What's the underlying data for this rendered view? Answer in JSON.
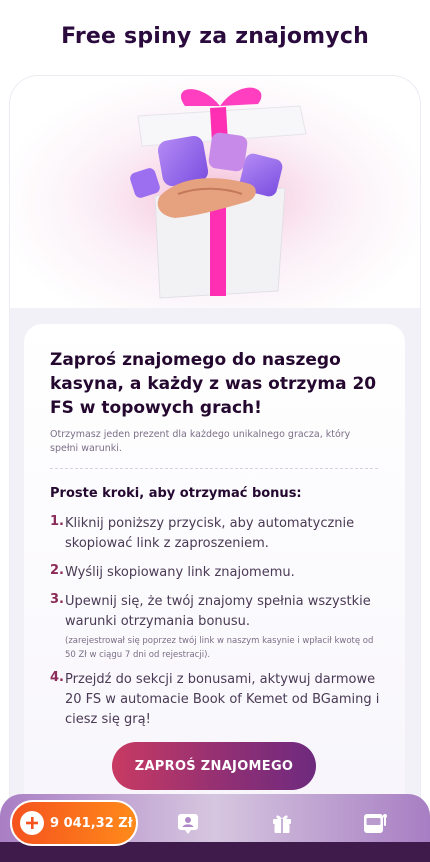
{
  "page": {
    "title": "Free spiny za znajomych"
  },
  "card": {
    "headline": "Zaproś znajomego do naszego kasyna, a każdy z was otrzyma 20 FS w topowych grach!",
    "note": "Otrzymasz jeden prezent dla każdego unikalnego gracza, który spełni warunki.",
    "steps_title": "Proste kroki, aby otrzymać bonus:",
    "steps": [
      {
        "num": "1.",
        "text": "Kliknij poniższy przycisk, aby automatycznie skopiować link z zaproszeniem."
      },
      {
        "num": "2.",
        "text": "Wyślij skopiowany link znajomemu."
      },
      {
        "num": "3.",
        "text": "Upewnij się, że twój znajomy spełnia wszystkie warunki otrzymania bonusu.",
        "small": "(zarejestrował się poprzez twój link w naszym kasynie i wpłacił kwotę od 50 Zł w ciągu 7 dni od rejestracji)."
      },
      {
        "num": "4.",
        "text": "Przejdź do sekcji z bonusami, aktywuj darmowe 20 FS w automacie Book of Kemet od BGaming i ciesz się grą!"
      }
    ],
    "invite_button": "ZAPROŚ ZNAJOMEGO"
  },
  "bottom_nav": {
    "balance": "9 041,32 Zł",
    "icons": [
      "profile-icon",
      "gift-icon",
      "slot-machine-icon"
    ]
  },
  "colors": {
    "accent": "#8d2f75",
    "balance": "#f5531e",
    "title": "#2b0b3e"
  }
}
